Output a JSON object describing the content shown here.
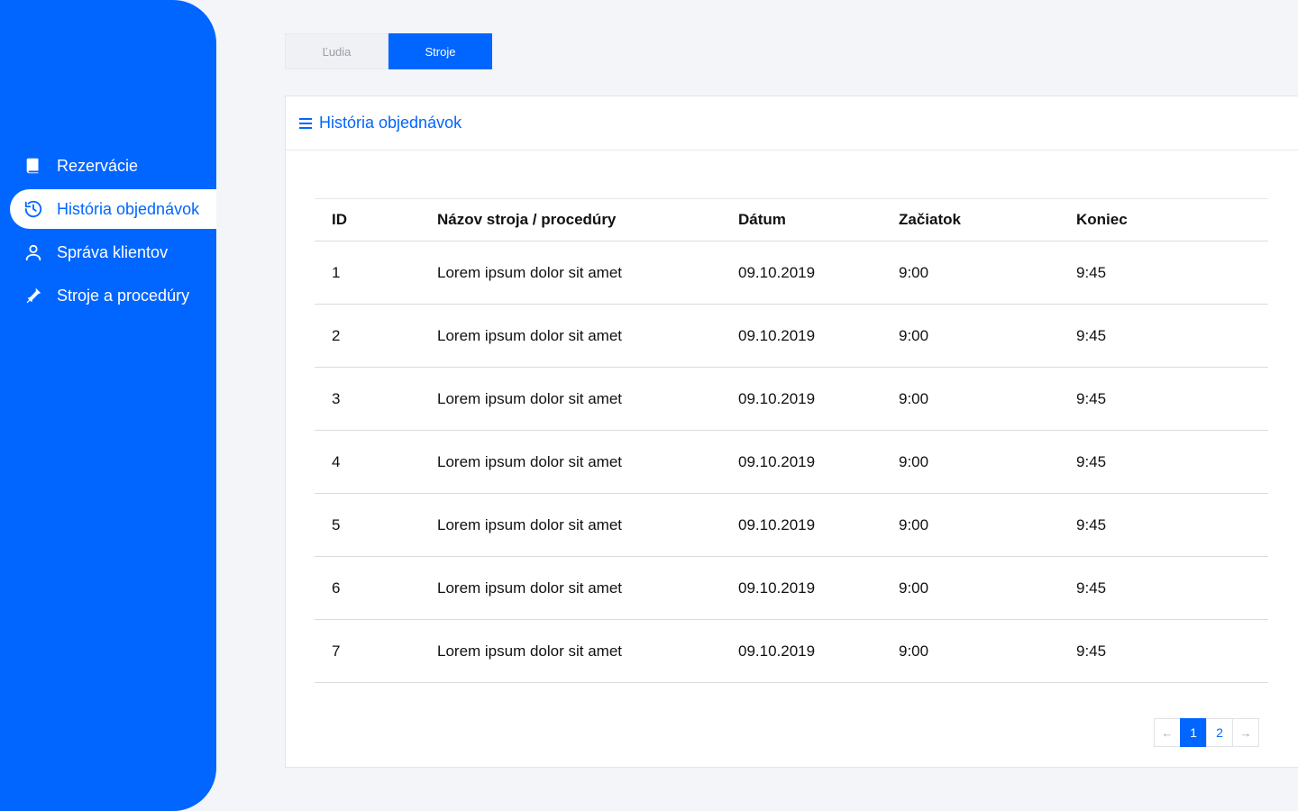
{
  "sidebar": {
    "items": [
      {
        "label": "Rezervácie",
        "icon": "book-icon",
        "active": false
      },
      {
        "label": "História objednávok",
        "icon": "history-icon",
        "active": true
      },
      {
        "label": "Správa klientov",
        "icon": "user-icon",
        "active": false
      },
      {
        "label": "Stroje a procedúry",
        "icon": "tool-icon",
        "active": false
      }
    ]
  },
  "tabs": [
    {
      "label": "Ľudia",
      "active": false
    },
    {
      "label": "Stroje",
      "active": true
    }
  ],
  "card": {
    "title": "História objednávok",
    "table": {
      "headers": {
        "id": "ID",
        "name": "Názov stroja / procedúry",
        "date": "Dátum",
        "start": "Začiatok",
        "end": "Koniec"
      },
      "rows": [
        {
          "id": "1",
          "name": "Lorem ipsum dolor sit amet",
          "date": "09.10.2019",
          "start": "9:00",
          "end": "9:45"
        },
        {
          "id": "2",
          "name": "Lorem ipsum dolor sit amet",
          "date": "09.10.2019",
          "start": "9:00",
          "end": "9:45"
        },
        {
          "id": "3",
          "name": "Lorem ipsum dolor sit amet",
          "date": "09.10.2019",
          "start": "9:00",
          "end": "9:45"
        },
        {
          "id": "4",
          "name": "Lorem ipsum dolor sit amet",
          "date": "09.10.2019",
          "start": "9:00",
          "end": "9:45"
        },
        {
          "id": "5",
          "name": "Lorem ipsum dolor sit amet",
          "date": "09.10.2019",
          "start": "9:00",
          "end": "9:45"
        },
        {
          "id": "6",
          "name": "Lorem ipsum dolor sit amet",
          "date": "09.10.2019",
          "start": "9:00",
          "end": "9:45"
        },
        {
          "id": "7",
          "name": "Lorem ipsum dolor sit amet",
          "date": "09.10.2019",
          "start": "9:00",
          "end": "9:45"
        }
      ]
    },
    "pagination": {
      "prev": "←",
      "pages": [
        "1",
        "2"
      ],
      "current": "1",
      "next": "→"
    }
  },
  "colors": {
    "accent": "#0066ff",
    "background": "#f4f5f8"
  }
}
